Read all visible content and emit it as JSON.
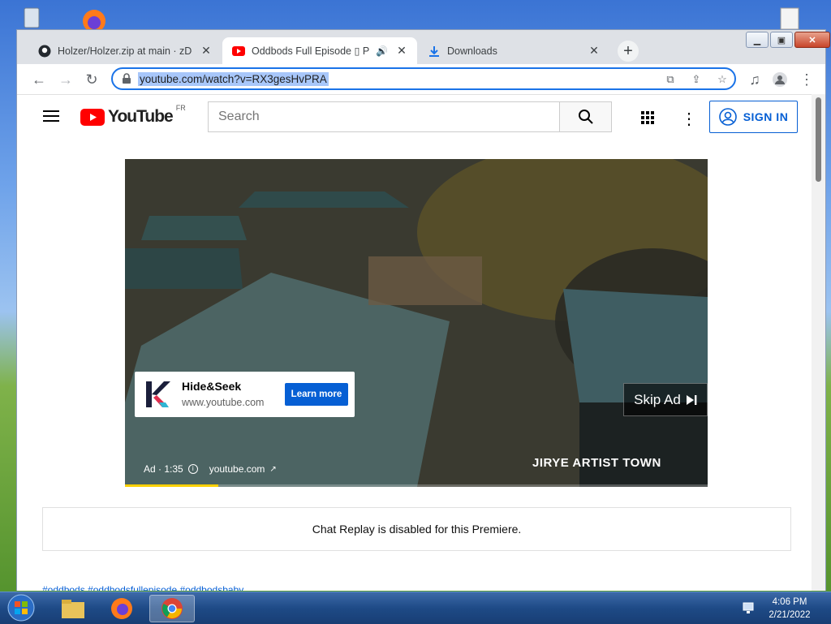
{
  "window": {
    "tabs": [
      {
        "title": "Holzer/Holzer.zip at main · zDon",
        "icon": "github-icon"
      },
      {
        "title": "Oddbods Full Episode ▯ Pop",
        "icon": "youtube-icon",
        "audio": true
      },
      {
        "title": "Downloads",
        "icon": "download-icon"
      }
    ],
    "url": "youtube.com/watch?v=RX3gesHvPRA"
  },
  "youtube": {
    "logo_text": "YouTube",
    "region": "FR",
    "search_placeholder": "Search",
    "sign_in": "SIGN IN"
  },
  "ad": {
    "advertiser": "Hide&Seek",
    "domain": "www.youtube.com",
    "cta": "Learn more",
    "skip_label": "Skip Ad",
    "ad_label": "Ad · 1:35",
    "ad_source": "youtube.com",
    "overlay_caption": "JIRYE ARTIST TOWN",
    "progress": 0.16
  },
  "chat": {
    "message": "Chat Replay is disabled for this Premiere."
  },
  "hashtags": "#oddbods #oddbodsfullepisode #oddbodsbaby",
  "taskbar": {
    "time": "4:06 PM",
    "date": "2/21/2022"
  },
  "colors": {
    "youtube_red": "#ff0000",
    "link_blue": "#065fd4",
    "url_highlight": "#a8c7fa"
  }
}
